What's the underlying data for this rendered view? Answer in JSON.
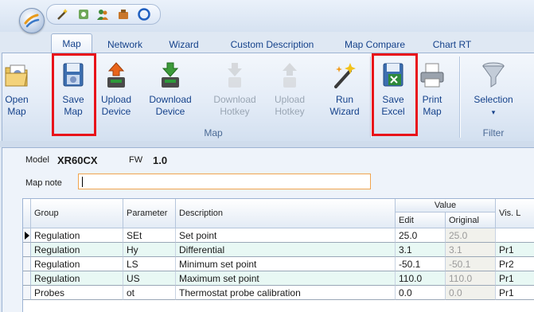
{
  "tabs": [
    {
      "label": "Map",
      "active": true
    },
    {
      "label": "Network"
    },
    {
      "label": "Wizard"
    },
    {
      "label": "Custom Description"
    },
    {
      "label": "Map Compare"
    },
    {
      "label": "Chart RT"
    }
  ],
  "ribbon": {
    "buttons": [
      {
        "line1": "Open",
        "line2": "Map",
        "icon": "open-map-icon"
      },
      {
        "line1": "Save",
        "line2": "Map",
        "icon": "save-map-icon",
        "highlighted": true
      },
      {
        "line1": "Upload",
        "line2": "Device",
        "icon": "upload-device-icon"
      },
      {
        "line1": "Download",
        "line2": "Device",
        "icon": "download-device-icon"
      },
      {
        "line1": "Download",
        "line2": "Hotkey",
        "icon": "download-hotkey-icon",
        "disabled": true
      },
      {
        "line1": "Upload",
        "line2": "Hotkey",
        "icon": "upload-hotkey-icon",
        "disabled": true
      },
      {
        "line1": "Run",
        "line2": "Wizard",
        "icon": "magic-wand-icon"
      },
      {
        "line1": "Save",
        "line2": "Excel",
        "icon": "save-excel-icon",
        "highlighted": true
      },
      {
        "line1": "Print",
        "line2": "Map",
        "icon": "printer-icon"
      },
      {
        "line1": "Selection",
        "line2": "▾",
        "icon": "funnel-icon"
      }
    ],
    "groups": {
      "map": "Map",
      "filter": "Filter"
    }
  },
  "model": {
    "label": "Model",
    "value": "XR60CX"
  },
  "fw": {
    "label": "FW",
    "value": "1.0"
  },
  "map_note": {
    "label": "Map note",
    "value": ""
  },
  "grid": {
    "headers": {
      "group": "Group",
      "parameter": "Parameter",
      "description": "Description",
      "value": "Value",
      "edit": "Edit",
      "original": "Original",
      "vis": "Vis. L"
    },
    "rows": [
      {
        "group": "Regulation",
        "parameter": "SEt",
        "description": "Set point",
        "edit": "25.0",
        "original": "25.0",
        "vis": "",
        "selected": true
      },
      {
        "group": "Regulation",
        "parameter": "Hy",
        "description": "Differential",
        "edit": "3.1",
        "original": "3.1",
        "vis": "Pr1"
      },
      {
        "group": "Regulation",
        "parameter": "LS",
        "description": "Minimum set point",
        "edit": "-50.1",
        "original": "-50.1",
        "vis": "Pr2"
      },
      {
        "group": "Regulation",
        "parameter": "US",
        "description": "Maximum set point",
        "edit": "110.0",
        "original": "110.0",
        "vis": "Pr1"
      },
      {
        "group": "Probes",
        "parameter": "ot",
        "description": "Thermostat probe calibration",
        "edit": "0.0",
        "original": "0.0",
        "vis": "Pr1"
      }
    ]
  },
  "colors": {
    "highlight": "#e8131a",
    "ribbon_text": "#15428b",
    "row_alt": "#e8f8f4",
    "input_border": "#f0a44e"
  }
}
